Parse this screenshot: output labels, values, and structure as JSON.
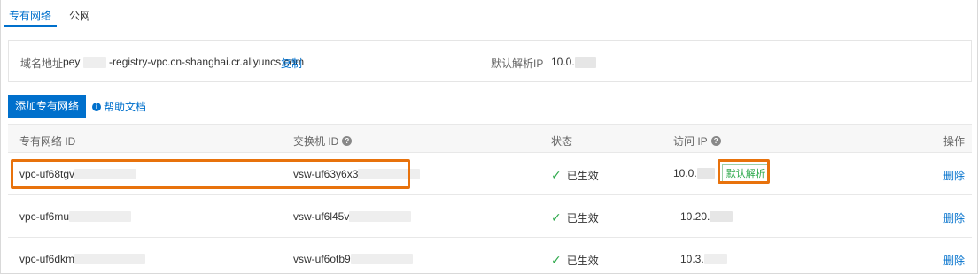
{
  "tabs": [
    {
      "label": "专有网络",
      "active": true
    },
    {
      "label": "公网",
      "active": false
    }
  ],
  "domain_info": {
    "label": "域名地址",
    "value_prefix": "pey",
    "value_suffix": "-registry-vpc.cn-shanghai.cr.aliyuncs.com",
    "copy_label": "复制",
    "resolve_label": "默认解析IP",
    "resolve_value_prefix": "10.0."
  },
  "toolbar": {
    "add_label": "添加专有网络",
    "help_label": "帮助文档"
  },
  "table": {
    "headers": {
      "vpc_id": "专有网络 ID",
      "vswitch_id": "交换机 ID",
      "status": "状态",
      "ip": "访问 IP",
      "action": "操作"
    },
    "rows": [
      {
        "vpc_id": "vpc-uf68tgv",
        "vswitch_id": "vsw-uf63y6x3",
        "status": "已生效",
        "ip": "10.0.",
        "default_label": "默认解析",
        "action": "删除"
      },
      {
        "vpc_id": "vpc-uf6mu",
        "vswitch_id": "vsw-uf6l45v",
        "status": "已生效",
        "ip": "10.20.",
        "action": "删除"
      },
      {
        "vpc_id": "vpc-uf6dkm",
        "vswitch_id": "vsw-uf6otb9",
        "status": "已生效",
        "ip": "10.3.",
        "action": "删除"
      }
    ]
  },
  "colors": {
    "accent": "#0070cc",
    "success": "#2ca84a",
    "highlight": "#e8720c"
  }
}
